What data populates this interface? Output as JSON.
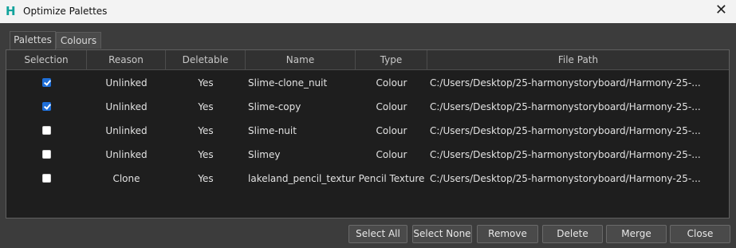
{
  "window": {
    "title": "Optimize Palettes",
    "app_icon_glyph": "H",
    "close_glyph": "✕"
  },
  "tabs": [
    {
      "label": "Palettes",
      "active": true
    },
    {
      "label": "Colours",
      "active": false
    }
  ],
  "table": {
    "headers": [
      "Selection",
      "Reason",
      "Deletable",
      "Name",
      "Type",
      "File Path"
    ],
    "rows": [
      {
        "selected": true,
        "reason": "Unlinked",
        "deletable": "Yes",
        "name": "Slime-clone_nuit",
        "type": "Colour",
        "path": "C:/Users/Desktop/25-harmonystoryboard/Harmony-25-..."
      },
      {
        "selected": true,
        "reason": "Unlinked",
        "deletable": "Yes",
        "name": "Slime-copy",
        "type": "Colour",
        "path": "C:/Users/Desktop/25-harmonystoryboard/Harmony-25-..."
      },
      {
        "selected": false,
        "reason": "Unlinked",
        "deletable": "Yes",
        "name": "Slime-nuit",
        "type": "Colour",
        "path": "C:/Users/Desktop/25-harmonystoryboard/Harmony-25-..."
      },
      {
        "selected": false,
        "reason": "Unlinked",
        "deletable": "Yes",
        "name": "Slimey",
        "type": "Colour",
        "path": "C:/Users/Desktop/25-harmonystoryboard/Harmony-25-..."
      },
      {
        "selected": false,
        "reason": "Clone",
        "deletable": "Yes",
        "name": "lakeland_pencil_texture",
        "type": "Pencil Texture",
        "path": "C:/Users/Desktop/25-harmonystoryboard/Harmony-25-..."
      }
    ]
  },
  "buttons": {
    "select_all": "Select All",
    "select_none": "Select None",
    "remove": "Remove",
    "delete": "Delete",
    "merge": "Merge",
    "close": "Close"
  },
  "colors": {
    "checkbox_checked": "#1f6fd8",
    "app_icon": "#12a39c"
  }
}
